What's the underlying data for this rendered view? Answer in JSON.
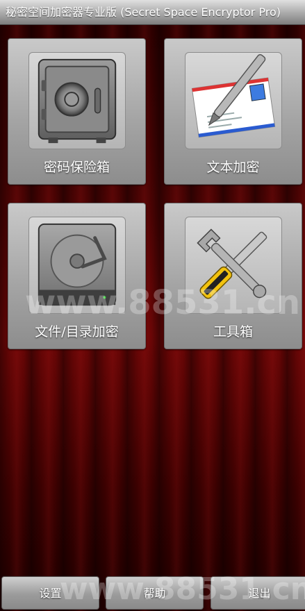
{
  "app": {
    "title": "秘密空间加密器专业版 (Secret Space Encryptor Pro)"
  },
  "tiles": [
    {
      "label": "密码保险箱",
      "icon": "safe-icon"
    },
    {
      "label": "文本加密",
      "icon": "envelope-pen-icon"
    },
    {
      "label": "文件/目录加密",
      "icon": "hard-drive-icon"
    },
    {
      "label": "工具箱",
      "icon": "tools-icon"
    }
  ],
  "bottom_bar": {
    "settings_label": "设置",
    "help_label": "帮助",
    "exit_label": "退出"
  },
  "watermarks": {
    "center": "www.88531.cn",
    "bottom": "www.88531.cn"
  },
  "colors": {
    "background_red": "#4a0303",
    "title_bar_gray": "#a9a9a9",
    "tile_gray": "#a5a5a5"
  }
}
